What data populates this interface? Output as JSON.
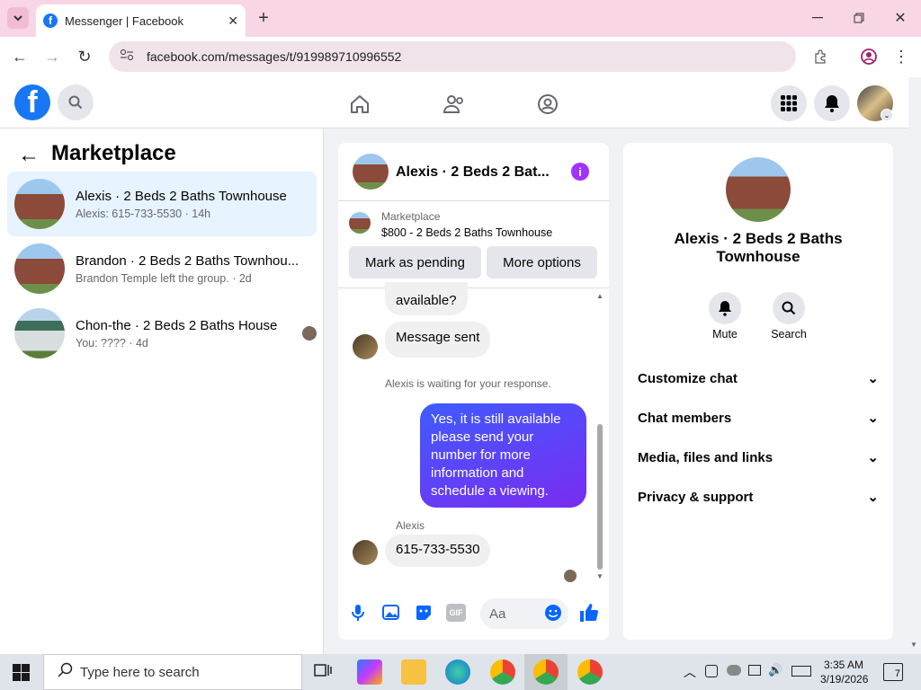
{
  "browser": {
    "tab_title": "Messenger | Facebook",
    "url": "facebook.com/messages/t/919989710996552"
  },
  "left_panel": {
    "title": "Marketplace",
    "conversations": [
      {
        "name": "Alexis · 2 Beds 2 Baths Townhouse",
        "preview": "Alexis: 615-733-5530 · 14h"
      },
      {
        "name": "Brandon · 2 Beds 2 Baths Townhou...",
        "preview": "Brandon Temple left the group. · 2d"
      },
      {
        "name": "Chon-the · 2 Beds 2 Baths House",
        "preview": "You: ???? · 4d"
      }
    ]
  },
  "chat": {
    "title": "Alexis · 2 Beds 2 Bat...",
    "marketplace_label": "Marketplace",
    "listing": "$800 - 2 Beds 2 Baths Townhouse",
    "mark_pending": "Mark as pending",
    "more_options": "More options",
    "messages": {
      "partial": "available?",
      "sent_notice": "Message sent",
      "waiting": "Alexis is waiting for your response.",
      "outgoing": "Yes, it is still available please send your number for more information and schedule a viewing.",
      "sender": "Alexis",
      "incoming": "615-733-5530"
    },
    "input_placeholder": "Aa",
    "gif_label": "GIF"
  },
  "info_panel": {
    "name": "Alexis · 2 Beds 2 Baths Townhouse",
    "mute": "Mute",
    "search": "Search",
    "sections": [
      "Customize chat",
      "Chat members",
      "Media, files and links",
      "Privacy & support"
    ]
  },
  "taskbar": {
    "search_placeholder": "Type here to search",
    "time": "3:35 AM",
    "date": "3/19/2026",
    "notifications": "7"
  },
  "colors": {
    "fb_blue": "#1877f2",
    "accent_purple": "#a033ff",
    "bubble_gradient_start": "#3f5bff",
    "bubble_gradient_end": "#7a2cf0"
  }
}
